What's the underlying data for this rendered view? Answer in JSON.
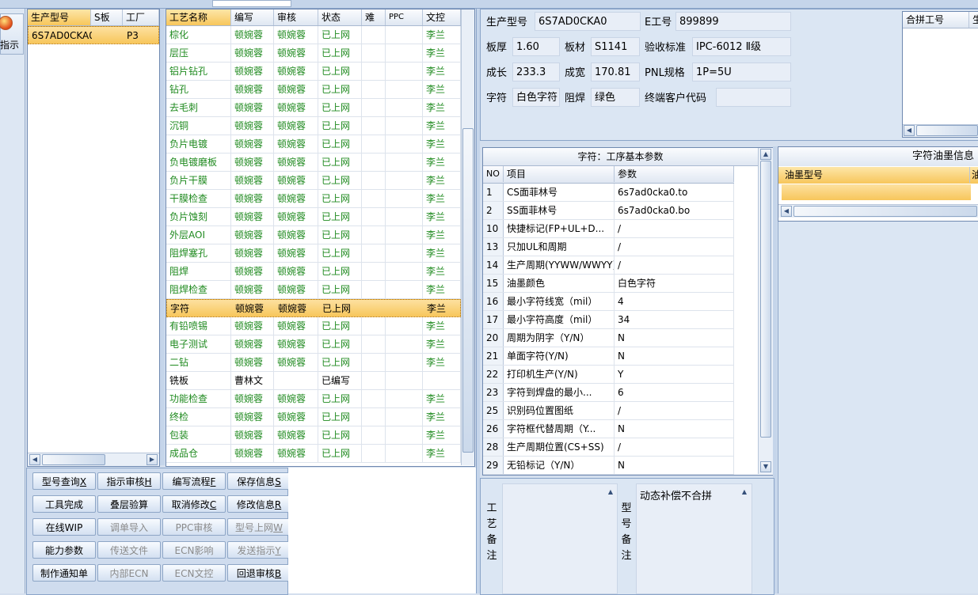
{
  "rail": {
    "button_label": "指示"
  },
  "left_grid": {
    "columns": [
      "生产型号",
      "S板",
      "工厂"
    ],
    "rows": [
      {
        "model": "6S7AD0CKA0",
        "s": "",
        "factory": "P3"
      }
    ]
  },
  "process_grid": {
    "columns": [
      "工艺名称",
      "编写",
      "审核",
      "状态",
      "难",
      "PPC",
      "文控"
    ],
    "rows": [
      {
        "name": "棕化",
        "writer": "顿婉蓉",
        "reviewer": "顿婉蓉",
        "status": "已上网",
        "doc": "李兰"
      },
      {
        "name": "层压",
        "writer": "顿婉蓉",
        "reviewer": "顿婉蓉",
        "status": "已上网",
        "doc": "李兰"
      },
      {
        "name": "铝片钻孔",
        "writer": "顿婉蓉",
        "reviewer": "顿婉蓉",
        "status": "已上网",
        "doc": "李兰"
      },
      {
        "name": "钻孔",
        "writer": "顿婉蓉",
        "reviewer": "顿婉蓉",
        "status": "已上网",
        "doc": "李兰"
      },
      {
        "name": "去毛刺",
        "writer": "顿婉蓉",
        "reviewer": "顿婉蓉",
        "status": "已上网",
        "doc": "李兰"
      },
      {
        "name": "沉铜",
        "writer": "顿婉蓉",
        "reviewer": "顿婉蓉",
        "status": "已上网",
        "doc": "李兰"
      },
      {
        "name": "负片电镀",
        "writer": "顿婉蓉",
        "reviewer": "顿婉蓉",
        "status": "已上网",
        "doc": "李兰"
      },
      {
        "name": "负电镀磨板",
        "writer": "顿婉蓉",
        "reviewer": "顿婉蓉",
        "status": "已上网",
        "doc": "李兰"
      },
      {
        "name": "负片干膜",
        "writer": "顿婉蓉",
        "reviewer": "顿婉蓉",
        "status": "已上网",
        "doc": "李兰"
      },
      {
        "name": "干膜检查",
        "writer": "顿婉蓉",
        "reviewer": "顿婉蓉",
        "status": "已上网",
        "doc": "李兰"
      },
      {
        "name": "负片蚀刻",
        "writer": "顿婉蓉",
        "reviewer": "顿婉蓉",
        "status": "已上网",
        "doc": "李兰"
      },
      {
        "name": "外层AOI",
        "writer": "顿婉蓉",
        "reviewer": "顿婉蓉",
        "status": "已上网",
        "doc": "李兰"
      },
      {
        "name": "阻焊塞孔",
        "writer": "顿婉蓉",
        "reviewer": "顿婉蓉",
        "status": "已上网",
        "doc": "李兰"
      },
      {
        "name": "阻焊",
        "writer": "顿婉蓉",
        "reviewer": "顿婉蓉",
        "status": "已上网",
        "doc": "李兰"
      },
      {
        "name": "阻焊检查",
        "writer": "顿婉蓉",
        "reviewer": "顿婉蓉",
        "status": "已上网",
        "doc": "李兰"
      },
      {
        "name": "字符",
        "writer": "顿婉蓉",
        "reviewer": "顿婉蓉",
        "status": "已上网",
        "doc": "李兰",
        "selected": true
      },
      {
        "name": "有铅喷锡",
        "writer": "顿婉蓉",
        "reviewer": "顿婉蓉",
        "status": "已上网",
        "doc": "李兰"
      },
      {
        "name": "电子测试",
        "writer": "顿婉蓉",
        "reviewer": "顿婉蓉",
        "status": "已上网",
        "doc": "李兰"
      },
      {
        "name": "二钻",
        "writer": "顿婉蓉",
        "reviewer": "顿婉蓉",
        "status": "已上网",
        "doc": "李兰"
      },
      {
        "name": "铣板",
        "writer": "曹林文",
        "reviewer": "",
        "status": "已编写",
        "doc": "",
        "plain": true
      },
      {
        "name": "功能检查",
        "writer": "顿婉蓉",
        "reviewer": "顿婉蓉",
        "status": "已上网",
        "doc": "李兰"
      },
      {
        "name": "终检",
        "writer": "顿婉蓉",
        "reviewer": "顿婉蓉",
        "status": "已上网",
        "doc": "李兰"
      },
      {
        "name": "包装",
        "writer": "顿婉蓉",
        "reviewer": "顿婉蓉",
        "status": "已上网",
        "doc": "李兰"
      },
      {
        "name": "成品仓",
        "writer": "顿婉蓉",
        "reviewer": "顿婉蓉",
        "status": "已上网",
        "doc": "李兰"
      }
    ]
  },
  "buttons": [
    {
      "label": "型号查询",
      "key": "X",
      "enabled": true
    },
    {
      "label": "指示审核",
      "key": "H",
      "enabled": true
    },
    {
      "label": "编写流程",
      "key": "F",
      "enabled": true
    },
    {
      "label": "保存信息",
      "key": "S",
      "enabled": true
    },
    {
      "label": "工具完成",
      "key": "",
      "enabled": true
    },
    {
      "label": "叠层验算",
      "key": "",
      "enabled": true
    },
    {
      "label": "取消修改",
      "key": "C",
      "enabled": true
    },
    {
      "label": "修改信息",
      "key": "R",
      "enabled": true
    },
    {
      "label": "在线WIP",
      "key": "",
      "enabled": true
    },
    {
      "label": "调单导入",
      "key": "",
      "enabled": false
    },
    {
      "label": "PPC审核",
      "key": "",
      "enabled": false
    },
    {
      "label": "型号上网",
      "key": "W",
      "enabled": false
    },
    {
      "label": "能力参数",
      "key": "",
      "enabled": true
    },
    {
      "label": "传送文件",
      "key": "",
      "enabled": false
    },
    {
      "label": "ECN影响",
      "key": "",
      "enabled": false
    },
    {
      "label": "发送指示",
      "key": "Y",
      "enabled": false
    },
    {
      "label": "制作通知单",
      "key": "",
      "enabled": true
    },
    {
      "label": "内部ECN",
      "key": "",
      "enabled": false
    },
    {
      "label": "ECN文控",
      "key": "",
      "enabled": false
    },
    {
      "label": "回退审核",
      "key": "B",
      "enabled": true
    }
  ],
  "info": {
    "model_label": "生产型号",
    "model_value": "6S7AD0CKA0",
    "e_label": "E工号",
    "e_value": "899899",
    "thick_label": "板厚",
    "thick_value": "1.60",
    "mat_label": "板材",
    "mat_value": "S1141",
    "std_label": "验收标准",
    "std_value": "IPC-6012 Ⅱ级",
    "len_label": "成长",
    "len_value": "233.3",
    "wid_label": "成宽",
    "wid_value": "170.81",
    "pnl_label": "PNL规格",
    "pnl_value": "1P=5U",
    "char_label": "字符",
    "char_value": "白色字符",
    "mask_label": "阻焊",
    "mask_value": "绿色",
    "cust_label": "终端客户代码",
    "cust_value": ""
  },
  "merge_grid": {
    "col1": "合拼工号",
    "col2": "生"
  },
  "params": {
    "title": "字符：工序基本参数",
    "columns": [
      "NO",
      "项目",
      "参数"
    ],
    "rows": [
      {
        "no": "1",
        "item": "CS面菲林号",
        "value": "6s7ad0cka0.to"
      },
      {
        "no": "2",
        "item": "SS面菲林号",
        "value": "6s7ad0cka0.bo"
      },
      {
        "no": "10",
        "item": "快捷标记(FP+UL+D...",
        "value": "/"
      },
      {
        "no": "13",
        "item": "只加UL和周期",
        "value": "/"
      },
      {
        "no": "14",
        "item": "生产周期(YYWW/WWYY)",
        "value": "/"
      },
      {
        "no": "15",
        "item": "油墨颜色",
        "value": "白色字符"
      },
      {
        "no": "16",
        "item": "最小字符线宽（mil）",
        "value": "4"
      },
      {
        "no": "17",
        "item": "最小字符高度（mil）",
        "value": "34"
      },
      {
        "no": "20",
        "item": "周期为阴字（Y/N）",
        "value": "N"
      },
      {
        "no": "21",
        "item": "单面字符(Y/N)",
        "value": "N"
      },
      {
        "no": "22",
        "item": "打印机生产(Y/N)",
        "value": "Y"
      },
      {
        "no": "23",
        "item": "字符到焊盘的最小...",
        "value": "6"
      },
      {
        "no": "25",
        "item": "识别码位置图纸",
        "value": "/"
      },
      {
        "no": "26",
        "item": "字符框代替周期（Y...",
        "value": "N"
      },
      {
        "no": "28",
        "item": "生产周期位置(CS+SS)",
        "value": "/"
      },
      {
        "no": "29",
        "item": "无铅标记（Y/N）",
        "value": "N"
      }
    ]
  },
  "oil": {
    "title": "字符油墨信息",
    "col1": "油墨型号",
    "col2": "油"
  },
  "remarks": {
    "process_label": [
      "工",
      "艺",
      "备",
      "注"
    ],
    "model_label": [
      "型",
      "号",
      "备",
      "注"
    ],
    "model_note": "动态补偿不合拼"
  }
}
